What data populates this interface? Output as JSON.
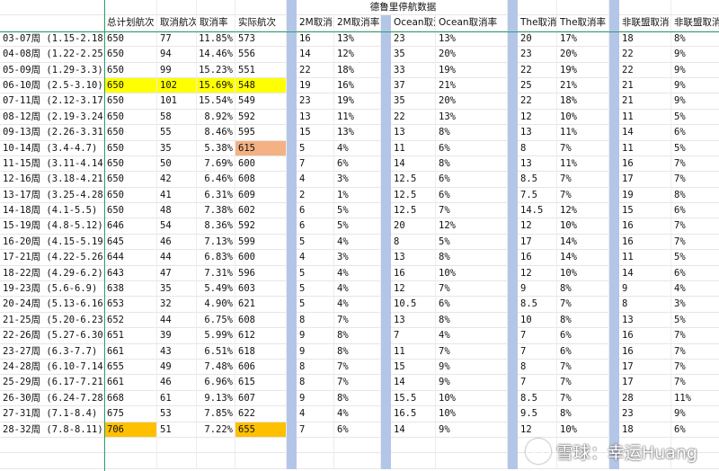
{
  "sheet": {
    "title": "德鲁里停航数据",
    "headers": [
      "",
      "总计划航次",
      "取消航次",
      "取消率",
      "实际航次",
      "",
      "2M取消",
      "2M取消率",
      "",
      "Ocean取消",
      "Ocean取消率",
      "",
      "The取消",
      "The取消率",
      "",
      "非联盟取消",
      "非联盟取消率",
      ""
    ],
    "rows": [
      {
        "c": [
          "03-07周 (1.15-2.18)",
          "650",
          "77",
          "11.85%",
          "573",
          "",
          "16",
          "13%",
          "",
          "23",
          "13%",
          "",
          "20",
          "17%",
          "",
          "18",
          "8%",
          ""
        ]
      },
      {
        "c": [
          "04-08周 (1.22-2.25)",
          "650",
          "94",
          "14.46%",
          "556",
          "",
          "14",
          "12%",
          "",
          "35",
          "20%",
          "",
          "23",
          "20%",
          "",
          "22",
          "9%",
          ""
        ]
      },
      {
        "c": [
          "05-09周 (1.29-3.3)",
          "650",
          "99",
          "15.23%",
          "551",
          "",
          "22",
          "18%",
          "",
          "33",
          "19%",
          "",
          "22",
          "19%",
          "",
          "22",
          "9%",
          ""
        ]
      },
      {
        "c": [
          "06-10周 (2.5-3.10)",
          "650",
          "102",
          "15.69%",
          "548",
          "",
          "19",
          "16%",
          "",
          "37",
          "21%",
          "",
          "25",
          "21%",
          "",
          "21",
          "9%",
          ""
        ],
        "hl": "yellow"
      },
      {
        "c": [
          "07-11周 (2.12-3.17)",
          "650",
          "101",
          "15.54%",
          "549",
          "",
          "23",
          "19%",
          "",
          "35",
          "20%",
          "",
          "22",
          "18%",
          "",
          "21",
          "9%",
          ""
        ]
      },
      {
        "c": [
          "08-12周 (2.19-3.24)",
          "650",
          "58",
          "8.92%",
          "592",
          "",
          "13",
          "11%",
          "",
          "22",
          "13%",
          "",
          "12",
          "10%",
          "",
          "11",
          "5%",
          ""
        ]
      },
      {
        "c": [
          "09-13周 (2.26-3.31)",
          "650",
          "55",
          "8.46%",
          "595",
          "",
          "15",
          "13%",
          "",
          "13",
          "8%",
          "",
          "13",
          "11%",
          "",
          "14",
          "6%",
          ""
        ]
      },
      {
        "c": [
          "10-14周 (3.4-4.7)",
          "650",
          "35",
          "5.38%",
          "615",
          "",
          "5",
          "4%",
          "",
          "11",
          "6%",
          "",
          "8",
          "7%",
          "",
          "11",
          "5%",
          ""
        ],
        "hl": "orange"
      },
      {
        "c": [
          "11-15周 (3.11-4.14)",
          "650",
          "50",
          "7.69%",
          "600",
          "",
          "7",
          "6%",
          "",
          "14",
          "8%",
          "",
          "13",
          "11%",
          "",
          "16",
          "7%",
          ""
        ]
      },
      {
        "c": [
          "12-16周 (3.18-4.21)",
          "650",
          "42",
          "6.46%",
          "608",
          "",
          "4",
          "3%",
          "",
          "12.5",
          "6%",
          "",
          "8.5",
          "7%",
          "",
          "17",
          "7%",
          ""
        ]
      },
      {
        "c": [
          "13-17周 (3.25-4.28)",
          "650",
          "41",
          "6.31%",
          "609",
          "",
          "2",
          "1%",
          "",
          "12.5",
          "6%",
          "",
          "7.5",
          "7%",
          "",
          "19",
          "8%",
          ""
        ]
      },
      {
        "c": [
          "14-18周 (4.1-5.5)",
          "650",
          "48",
          "7.38%",
          "602",
          "",
          "6",
          "5%",
          "",
          "12.5",
          "7%",
          "",
          "14.5",
          "12%",
          "",
          "15",
          "6%",
          ""
        ]
      },
      {
        "c": [
          "15-19周 (4.8-5.12)",
          "646",
          "54",
          "8.36%",
          "592",
          "",
          "6",
          "5%",
          "",
          "20",
          "12%",
          "",
          "12",
          "10%",
          "",
          "16",
          "7%",
          ""
        ]
      },
      {
        "c": [
          "16-20周 (4.15-5.19)",
          "645",
          "46",
          "7.13%",
          "599",
          "",
          "5",
          "4%",
          "",
          "8",
          "5%",
          "",
          "17",
          "14%",
          "",
          "16",
          "7%",
          ""
        ]
      },
      {
        "c": [
          "17-21周 (4.22-5.26)",
          "644",
          "44",
          "6.83%",
          "600",
          "",
          "4",
          "3%",
          "",
          "13",
          "8%",
          "",
          "16",
          "14%",
          "",
          "11",
          "5%",
          ""
        ]
      },
      {
        "c": [
          "18-22周 (4.29-6.2)",
          "643",
          "47",
          "7.31%",
          "596",
          "",
          "5",
          "4%",
          "",
          "16",
          "10%",
          "",
          "12",
          "10%",
          "",
          "14",
          "6%",
          ""
        ]
      },
      {
        "c": [
          "19-23周 (5.6-6.9)",
          "638",
          "35",
          "5.49%",
          "603",
          "",
          "5",
          "4%",
          "",
          "12",
          "7%",
          "",
          "9",
          "8%",
          "",
          "9",
          "4%",
          ""
        ]
      },
      {
        "c": [
          "20-24周 (5.13-6.16)",
          "653",
          "32",
          "4.90%",
          "621",
          "",
          "5",
          "4%",
          "",
          "10.5",
          "6%",
          "",
          "8.5",
          "7%",
          "",
          "8",
          "3%",
          ""
        ]
      },
      {
        "c": [
          "21-25周 (5.20-6.23)",
          "652",
          "44",
          "6.75%",
          "608",
          "",
          "8",
          "7%",
          "",
          "13",
          "8%",
          "",
          "10",
          "8%",
          "",
          "13",
          "5%",
          ""
        ]
      },
      {
        "c": [
          "22-26周 (5.27-6.30)",
          "651",
          "39",
          "5.99%",
          "612",
          "",
          "9",
          "8%",
          "",
          "7",
          "4%",
          "",
          "7",
          "6%",
          "",
          "16",
          "7%",
          ""
        ]
      },
      {
        "c": [
          "23-27周 (6.3-7.7)",
          "661",
          "43",
          "6.51%",
          "618",
          "",
          "9",
          "8%",
          "",
          "11",
          "7%",
          "",
          "7",
          "6%",
          "",
          "16",
          "7%",
          ""
        ]
      },
      {
        "c": [
          "24-28周 (6.10-7.14)",
          "655",
          "49",
          "7.48%",
          "606",
          "",
          "8",
          "7%",
          "",
          "15",
          "9%",
          "",
          "8",
          "7%",
          "",
          "17",
          "7%",
          ""
        ]
      },
      {
        "c": [
          "25-29周 (6.17-7.21)",
          "661",
          "46",
          "6.96%",
          "615",
          "",
          "8",
          "7%",
          "",
          "14",
          "9%",
          "",
          "7",
          "7%",
          "",
          "17",
          "7%",
          ""
        ]
      },
      {
        "c": [
          "26-30周 (6.24-7.28)",
          "668",
          "61",
          "9.13%",
          "607",
          "",
          "9",
          "8%",
          "",
          "15.5",
          "10%",
          "",
          "8.5",
          "7%",
          "",
          "28",
          "11%",
          ""
        ]
      },
      {
        "c": [
          "27-31周 (7.1-8.4)",
          "675",
          "53",
          "7.85%",
          "622",
          "",
          "4",
          "4%",
          "",
          "16.5",
          "10%",
          "",
          "9.5",
          "8%",
          "",
          "23",
          "9%",
          ""
        ]
      },
      {
        "c": [
          "28-32周 (7.8-8.11)",
          "706",
          "51",
          "7.22%",
          "655",
          "",
          "7",
          "6%",
          "",
          "14",
          "9%",
          "",
          "12",
          "10%",
          "",
          "18",
          "6%",
          ""
        ],
        "hl": "gold"
      }
    ]
  },
  "watermark": {
    "text": "雪球：幸运Huang",
    "icon": "snowball-logo-icon"
  },
  "colors": {
    "yellow": "#ffff00",
    "orange": "#f4b183",
    "gold": "#ffc000",
    "separator": "#b4c6e7",
    "freeze_line": "#2e9f6b"
  }
}
